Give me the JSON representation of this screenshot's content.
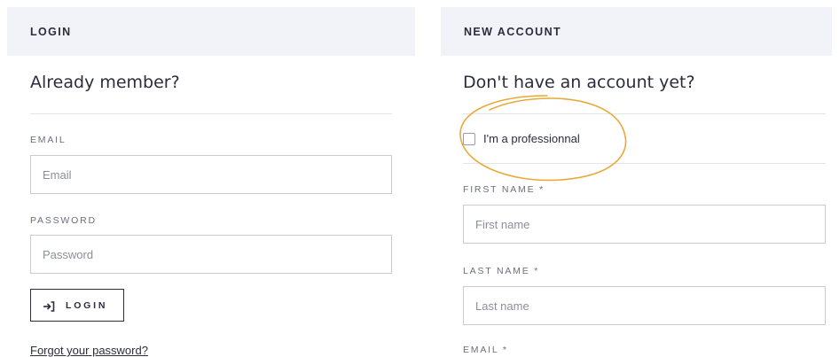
{
  "login": {
    "header": "LOGIN",
    "title": "Already member?",
    "email_label": "EMAIL",
    "email_placeholder": "Email",
    "password_label": "PASSWORD",
    "password_placeholder": "Password",
    "button_label": "LOGIN",
    "button_icon": "sign-in-icon",
    "forgot_link": "Forgot your password?"
  },
  "new_account": {
    "header": "NEW ACCOUNT",
    "title": "Don't have an account yet?",
    "professional_checkbox_label": "I'm a professionnal",
    "professional_checked": false,
    "first_name_label": "FIRST NAME *",
    "first_name_placeholder": "First name",
    "last_name_label": "LAST NAME *",
    "last_name_placeholder": "Last name",
    "email_label": "EMAIL *"
  },
  "colors": {
    "header_bg": "#f2f3f8",
    "text_dark": "#2b2d3c",
    "highlight": "#e8a93a"
  }
}
